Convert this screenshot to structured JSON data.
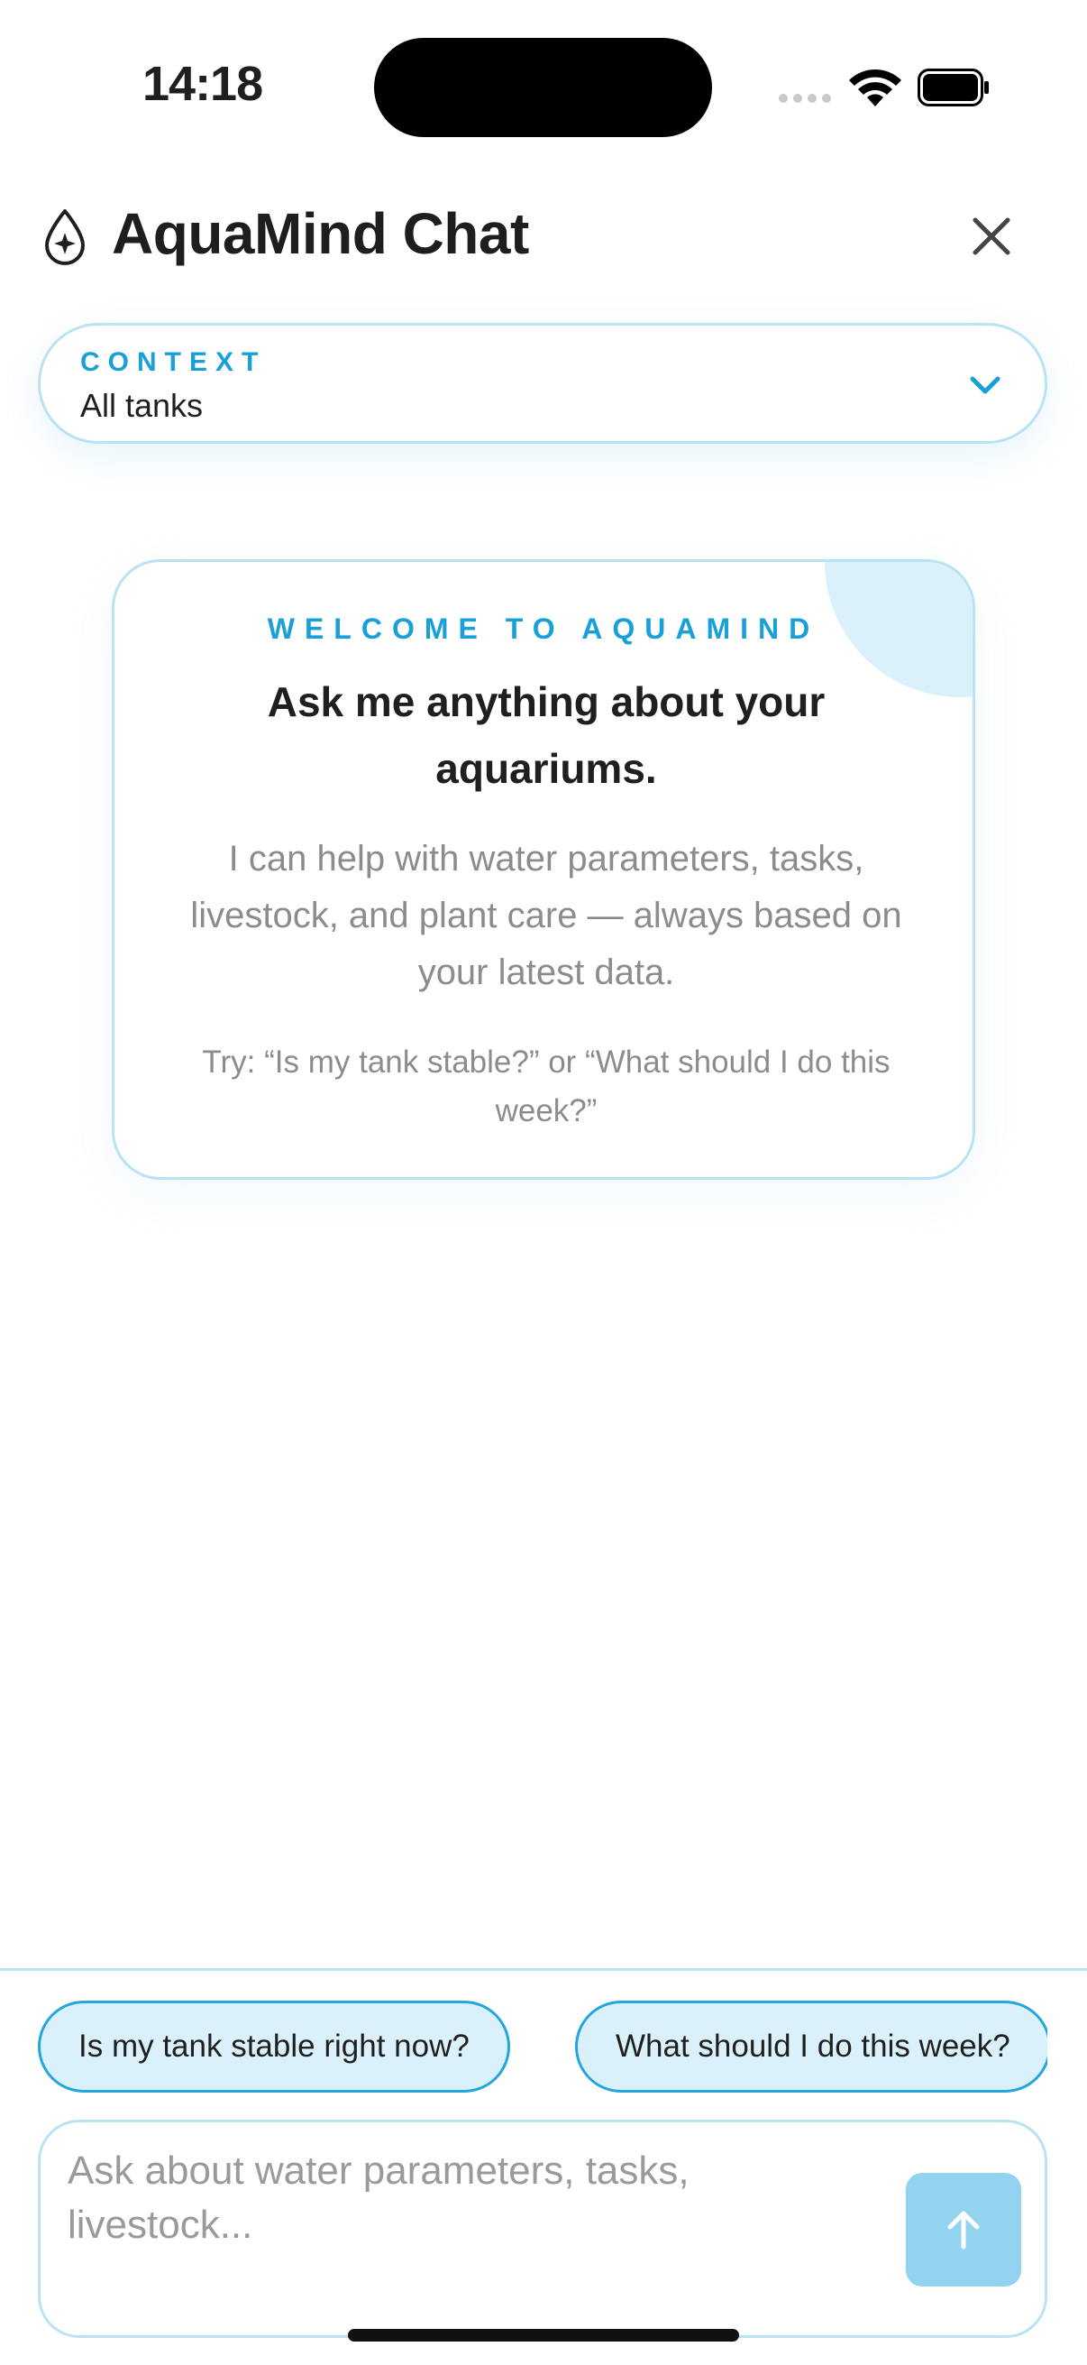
{
  "status_bar": {
    "time": "14:18"
  },
  "header": {
    "title": "AquaMind Chat"
  },
  "context": {
    "label": "CONTEXT",
    "value": "All tanks"
  },
  "welcome": {
    "eyebrow": "WELCOME TO AQUAMIND",
    "title": "Ask me anything about your aquariums.",
    "body": "I can help with water parameters, tasks, livestock, and plant care — always based on your latest data.",
    "tip": "Try: “Is my tank stable?” or “What should I do this week?”"
  },
  "suggestions": [
    {
      "label": "Is my tank stable right now?"
    },
    {
      "label": "What should I do this week?"
    }
  ],
  "composer": {
    "placeholder": "Ask about water parameters, tasks, livestock...",
    "value": ""
  },
  "colors": {
    "accent": "#1aa0d8",
    "border": "#b9e3f3",
    "chip_bg": "#daf1fb",
    "send_bg": "#93d3f0"
  },
  "icons": {
    "app": "water-drop-sparkle-icon",
    "close": "close-icon",
    "context": "chevron-down-icon",
    "send": "arrow-up-icon"
  }
}
